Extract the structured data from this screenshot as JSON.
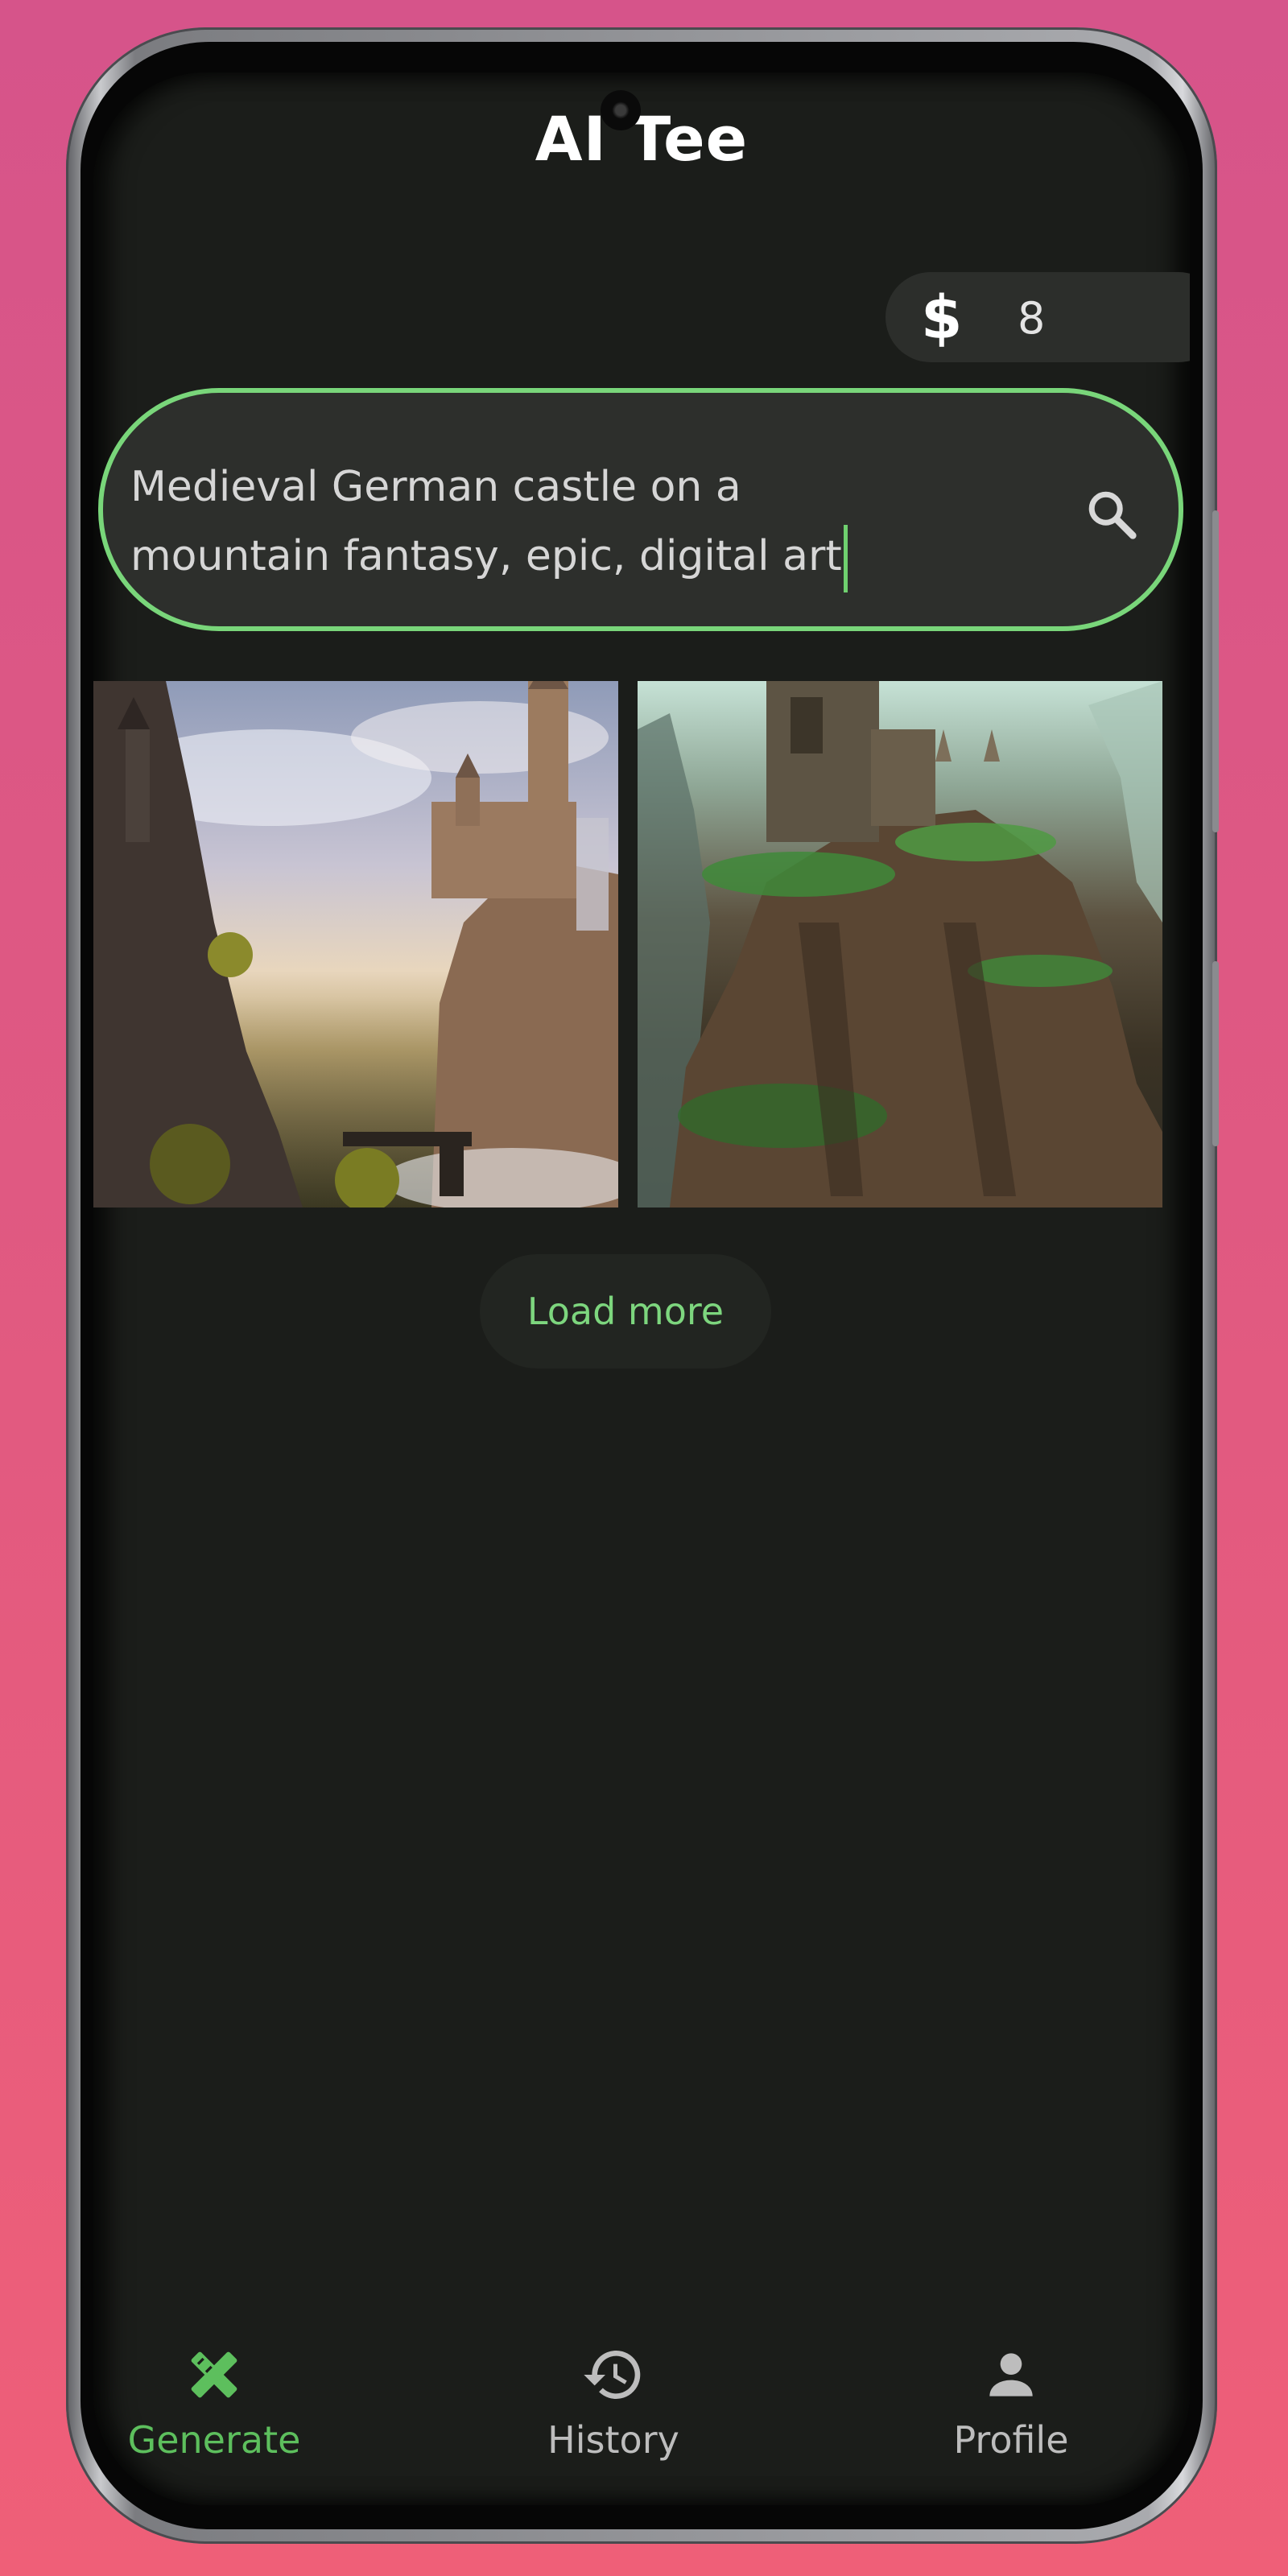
{
  "app": {
    "title": "AI Tee"
  },
  "credits": {
    "currency_symbol": "$",
    "count": "8"
  },
  "search": {
    "query": "Medieval German castle on a\nmountain fantasy, epic, digital art",
    "icon": "search-icon"
  },
  "results": {
    "images": [
      {
        "name": "castle-cliff-waterfall-image"
      },
      {
        "name": "castle-ruins-cliff-image"
      }
    ],
    "load_more_label": "Load more"
  },
  "bottom_nav": {
    "items": [
      {
        "label": "Generate",
        "icon": "pencil-ruler-icon",
        "active": true
      },
      {
        "label": "History",
        "icon": "history-icon",
        "active": false
      },
      {
        "label": "Profile",
        "icon": "person-icon",
        "active": false
      }
    ]
  },
  "colors": {
    "accent": "#79d67a",
    "background": "#1b1d1a",
    "surface": "#2c2e2b",
    "inactive": "#bdbdbd"
  }
}
